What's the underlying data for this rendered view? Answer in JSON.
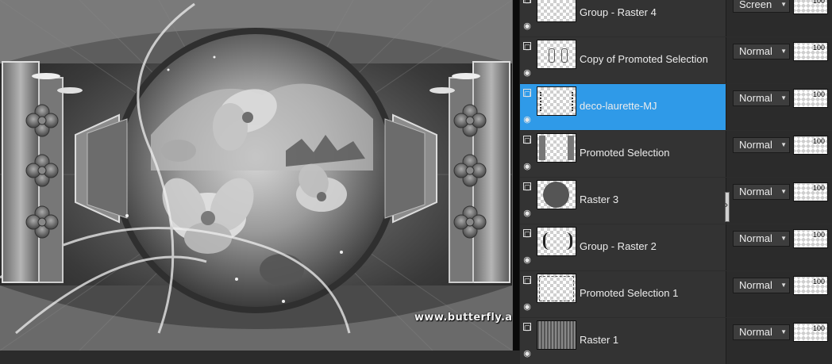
{
  "watermark": "www.butterfly.adv.br – Maria José",
  "layers": [
    {
      "name": "Group - Raster 4",
      "blend": "Screen",
      "opacity": "100",
      "selected": false,
      "thumb": "blank-thumbnail"
    },
    {
      "name": "Copy of Promoted Selection",
      "blend": "Normal",
      "opacity": "100",
      "selected": false,
      "thumb": "ornament-thumbnail"
    },
    {
      "name": "deco-laurette-MJ",
      "blend": "Normal",
      "opacity": "100",
      "selected": true,
      "thumb": "dots-thumbnail"
    },
    {
      "name": "Promoted Selection",
      "blend": "Normal",
      "opacity": "100",
      "selected": false,
      "thumb": "panel-thumbnail"
    },
    {
      "name": "Raster 3",
      "blend": "Normal",
      "opacity": "100",
      "selected": false,
      "thumb": "circle-thumbnail"
    },
    {
      "name": "Group - Raster 2",
      "blend": "Normal",
      "opacity": "100",
      "selected": false,
      "thumb": "brackets-thumbnail"
    },
    {
      "name": "Promoted Selection 1",
      "blend": "Normal",
      "opacity": "100",
      "selected": false,
      "thumb": "frame-thumbnail"
    },
    {
      "name": "Raster 1",
      "blend": "Normal",
      "opacity": "100",
      "selected": false,
      "thumb": "texture-thumbnail"
    }
  ],
  "colors": {
    "selected_row": "#2f9ae8",
    "panel_bg": "#2d2d2d",
    "text": "#ececec"
  },
  "icons": {
    "visibility_toggle": "layer-visibility-icon",
    "eye": "eye-icon",
    "dropdown": "chevron-down-icon"
  }
}
